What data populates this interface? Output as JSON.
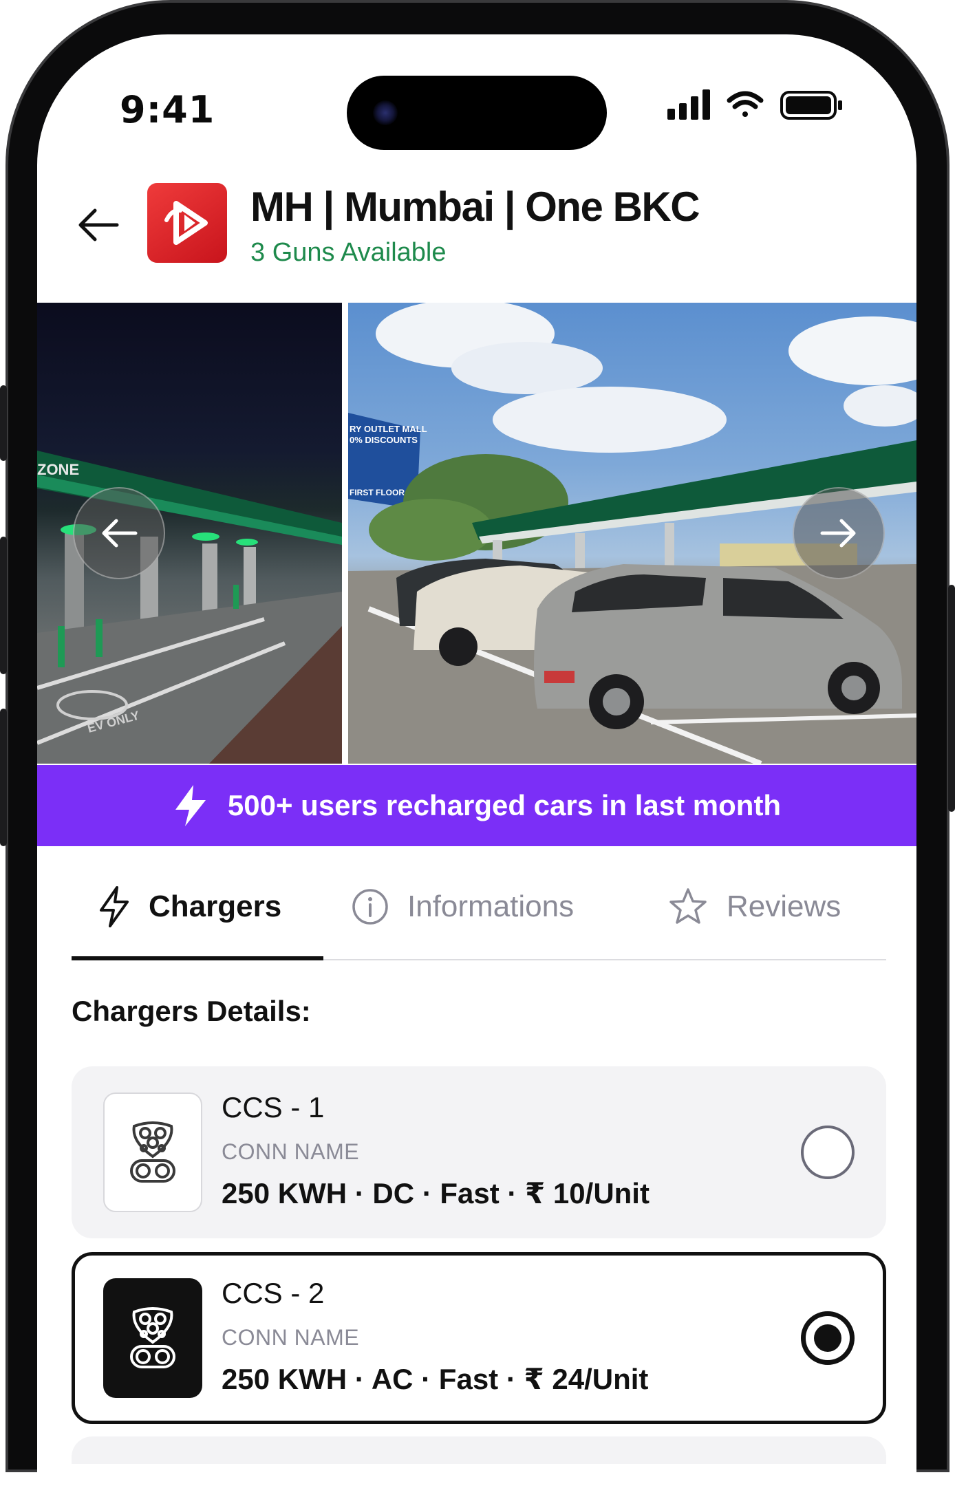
{
  "status_bar": {
    "time": "9:41"
  },
  "header": {
    "title": "MH | Mumbai | One BKC",
    "subtitle": "3 Guns Available"
  },
  "gallery": {
    "billboard_lines": [
      "RY OUTLET MALL",
      "0% DISCOUNTS",
      "FIRST FLOOR"
    ],
    "left_sign": "ZONE",
    "road_mark": "EV ONLY"
  },
  "promo": {
    "text": "500+ users recharged cars in last month"
  },
  "tabs": [
    {
      "label": "Chargers",
      "icon": "lightning-icon",
      "active": true
    },
    {
      "label": "Informations",
      "icon": "info-icon",
      "active": false
    },
    {
      "label": "Reviews",
      "icon": "star-icon",
      "active": false
    }
  ],
  "section": {
    "heading": "Chargers Details:"
  },
  "chargers": [
    {
      "name": "CCS - 1",
      "conn_label": "CONN NAME",
      "spec": "250 KWH · DC · Fast · ₹ 10/Unit",
      "selected": false,
      "icon": "ccs-connector-icon"
    },
    {
      "name": "CCS - 2",
      "conn_label": "CONN NAME",
      "spec": "250 KWH · AC · Fast · ₹ 24/Unit",
      "selected": true,
      "icon": "ccs-connector-icon"
    }
  ],
  "colors": {
    "accent_purple": "#7b2ff7",
    "available_green": "#1e8a4c",
    "brand_red": "#d62027"
  }
}
